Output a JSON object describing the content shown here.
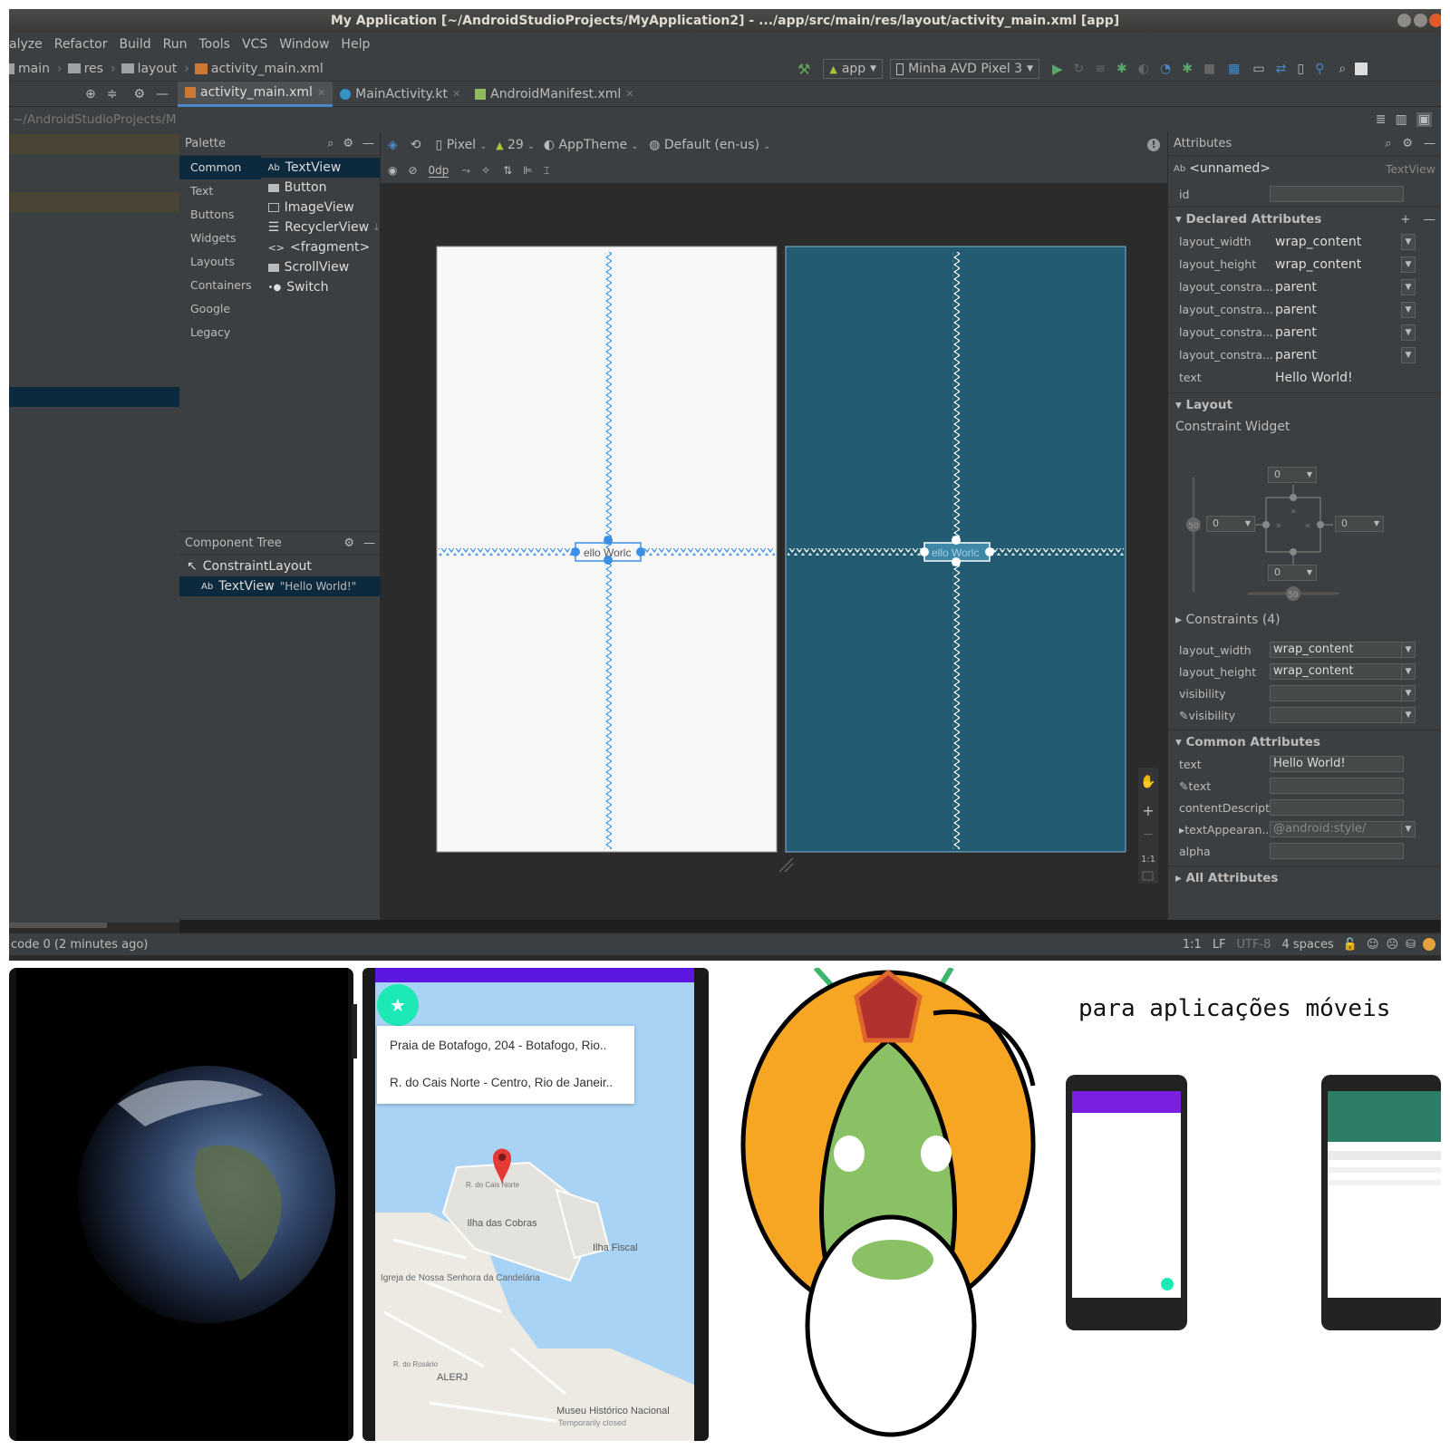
{
  "window": {
    "title": "My Application [~/AndroidStudioProjects/MyApplication2] - .../app/src/main/res/layout/activity_main.xml [app]"
  },
  "menu": [
    "alyze",
    "Refactor",
    "Build",
    "Run",
    "Tools",
    "VCS",
    "Window",
    "Help"
  ],
  "breadcrumb": {
    "main": "main",
    "res": "res",
    "layout": "layout",
    "file": "activity_main.xml"
  },
  "run": {
    "config": "app",
    "device": "Minha AVD Pixel 3"
  },
  "tabs": [
    {
      "label": "activity_main.xml",
      "active": true
    },
    {
      "label": "MainActivity.kt",
      "active": false
    },
    {
      "label": "AndroidManifest.xml",
      "active": false
    }
  ],
  "project": {
    "path": "~/AndroidStudioProjects/M"
  },
  "palette": {
    "title": "Palette",
    "categories": [
      "Common",
      "Text",
      "Buttons",
      "Widgets",
      "Layouts",
      "Containers",
      "Google",
      "Legacy"
    ],
    "items": [
      "TextView",
      "Button",
      "ImageView",
      "RecyclerView",
      "<fragment>",
      "ScrollView",
      "Switch"
    ]
  },
  "component_tree": {
    "title": "Component Tree",
    "root": "ConstraintLayout",
    "child": "TextView",
    "child_text": "\"Hello World!\""
  },
  "design_toolbar": {
    "device": "Pixel",
    "api": "29",
    "theme": "AppTheme",
    "locale": "Default (en-us)",
    "margin": "0dp"
  },
  "canvas": {
    "text_light": "ello Worlc",
    "text_dark": "ello Worlc",
    "zoom_label": "1:1"
  },
  "attributes": {
    "title": "Attributes",
    "component_name": "<unnamed>",
    "component_type": "TextView",
    "id_label": "id",
    "declared_title": "Declared Attributes",
    "declared": [
      {
        "k": "layout_width",
        "v": "wrap_content"
      },
      {
        "k": "layout_height",
        "v": "wrap_content"
      },
      {
        "k": "layout_constra...",
        "v": "parent"
      },
      {
        "k": "layout_constra...",
        "v": "parent"
      },
      {
        "k": "layout_constra...",
        "v": "parent"
      },
      {
        "k": "layout_constra...",
        "v": "parent"
      },
      {
        "k": "text",
        "v": "Hello World!"
      }
    ],
    "layout_title": "Layout",
    "constraint_widget": "Constraint Widget",
    "margins": {
      "top": "0",
      "left": "0",
      "right": "0",
      "bottom": "0",
      "bias_h": "50",
      "bias_v": "50"
    },
    "constraints_label": "Constraints (4)",
    "layout_fields": [
      {
        "k": "layout_width",
        "v": "wrap_content"
      },
      {
        "k": "layout_height",
        "v": "wrap_content"
      },
      {
        "k": "visibility",
        "v": ""
      },
      {
        "k": "visibility",
        "v": ""
      }
    ],
    "common_title": "Common Attributes",
    "common": [
      {
        "k": "text",
        "v": "Hello World!"
      },
      {
        "k": "text",
        "v": ""
      },
      {
        "k": "contentDescript...",
        "v": ""
      },
      {
        "k": "textAppearan...",
        "v": "@android:style/"
      },
      {
        "k": "alpha",
        "v": ""
      }
    ],
    "all_title": "All Attributes"
  },
  "status": {
    "left": "code 0 (2 minutes ago)",
    "pos": "1:1",
    "lf": "LF",
    "enc": "UTF-8",
    "indent": "4 spaces"
  },
  "map": {
    "results": [
      "Praia de Botafogo, 204 - Botafogo, Rio..",
      "R. do Cais Norte - Centro, Rio de Janeir.."
    ],
    "labels": [
      "Ilha das Cobras",
      "Ilha Fiscal",
      "Igreja de Nossa Senhora da Candelária",
      "ALERJ",
      "Museu Histórico Nacional",
      "Temporarily closed",
      "R. do Cais Norte",
      "R. do Rosário"
    ]
  },
  "slide": {
    "text": "para aplicações móveis"
  },
  "colors": {
    "accent": "#4a88c7",
    "blueprint": "#235b72",
    "selection": "#0d293e"
  }
}
